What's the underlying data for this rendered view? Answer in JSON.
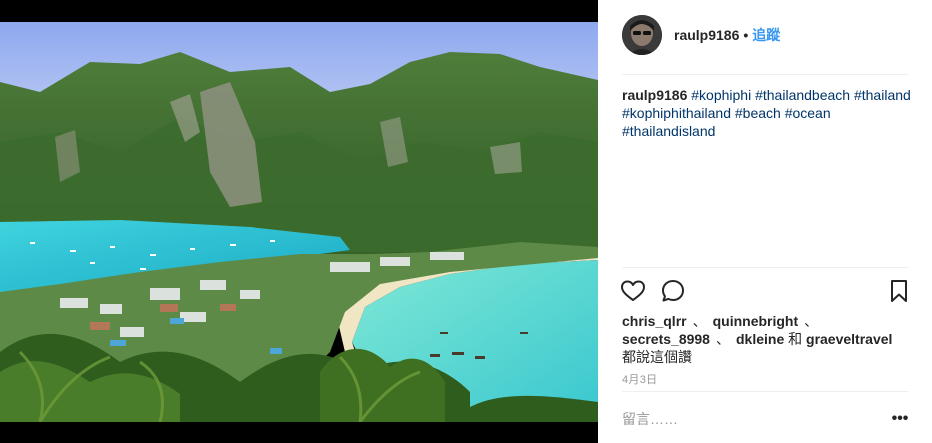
{
  "post": {
    "image_alt": "",
    "author": {
      "username": "raulp9186",
      "separator": "•",
      "follow_label": "追蹤"
    },
    "caption": {
      "username": "raulp9186",
      "hashtags": [
        "#kophiphi",
        "#thailandbeach",
        "#thailand",
        "#kophiphithailand",
        "#beach",
        "#ocean",
        "#thailandisland"
      ]
    },
    "actions": {
      "like_icon": "heart-icon",
      "comment_icon": "speech-bubble-icon",
      "save_icon": "bookmark-icon"
    },
    "likes": {
      "likers": [
        "chris_qlrr",
        "quinnebright",
        "secrets_8998",
        "dkleine"
      ],
      "separator": "、",
      "conjunction": "和",
      "last_liker": "graeveltravel",
      "suffix": "都說這個讚"
    },
    "date": "4月3日",
    "comment": {
      "placeholder": "留言……",
      "more_label": "•••"
    },
    "colors": {
      "accent": "#3897f0",
      "hashtag": "#003569",
      "meta": "#999999",
      "text": "#262626"
    }
  }
}
